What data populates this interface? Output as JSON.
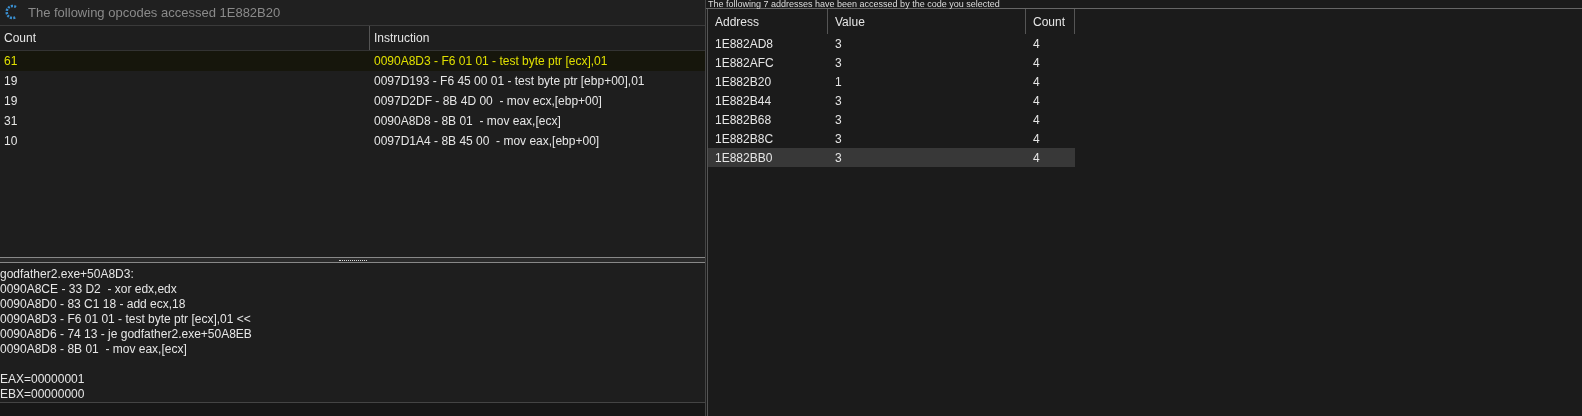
{
  "opcodes_window": {
    "title": "The following opcodes accessed 1E882B20",
    "table": {
      "columns": [
        "Count",
        "Instruction"
      ],
      "rows": [
        {
          "count": "61",
          "instruction": "0090A8D3 - F6 01 01 - test byte ptr [ecx],01",
          "selected": true
        },
        {
          "count": "19",
          "instruction": "0097D193 - F6 45 00 01 - test byte ptr [ebp+00],01",
          "selected": false
        },
        {
          "count": "19",
          "instruction": "0097D2DF - 8B 4D 00  - mov ecx,[ebp+00]",
          "selected": false
        },
        {
          "count": "31",
          "instruction": "0090A8D8 - 8B 01  - mov eax,[ecx]",
          "selected": false
        },
        {
          "count": "10",
          "instruction": "0097D1A4 - 8B 45 00  - mov eax,[ebp+00]",
          "selected": false
        }
      ]
    },
    "details": [
      "godfather2.exe+50A8D3:",
      "0090A8CE - 33 D2  - xor edx,edx",
      "0090A8D0 - 83 C1 18 - add ecx,18",
      "0090A8D3 - F6 01 01 - test byte ptr [ecx],01 <<",
      "0090A8D6 - 74 13 - je godfather2.exe+50A8EB",
      "0090A8D8 - 8B 01  - mov eax,[ecx]"
    ],
    "registers": [
      "EAX=00000001",
      "EBX=00000000"
    ]
  },
  "addresses_window": {
    "caption": "The following 7 addresses have been accessed by the code you selected",
    "table": {
      "columns": [
        "Address",
        "Value",
        "Count"
      ],
      "rows": [
        {
          "address": "1E882AD8",
          "value": "3",
          "count": "4",
          "selected": false
        },
        {
          "address": "1E882AFC",
          "value": "3",
          "count": "4",
          "selected": false
        },
        {
          "address": "1E882B20",
          "value": "1",
          "count": "4",
          "selected": false
        },
        {
          "address": "1E882B44",
          "value": "3",
          "count": "4",
          "selected": false
        },
        {
          "address": "1E882B68",
          "value": "3",
          "count": "4",
          "selected": false
        },
        {
          "address": "1E882B8C",
          "value": "3",
          "count": "4",
          "selected": false
        },
        {
          "address": "1E882BB0",
          "value": "3",
          "count": "4",
          "selected": true
        }
      ]
    }
  }
}
